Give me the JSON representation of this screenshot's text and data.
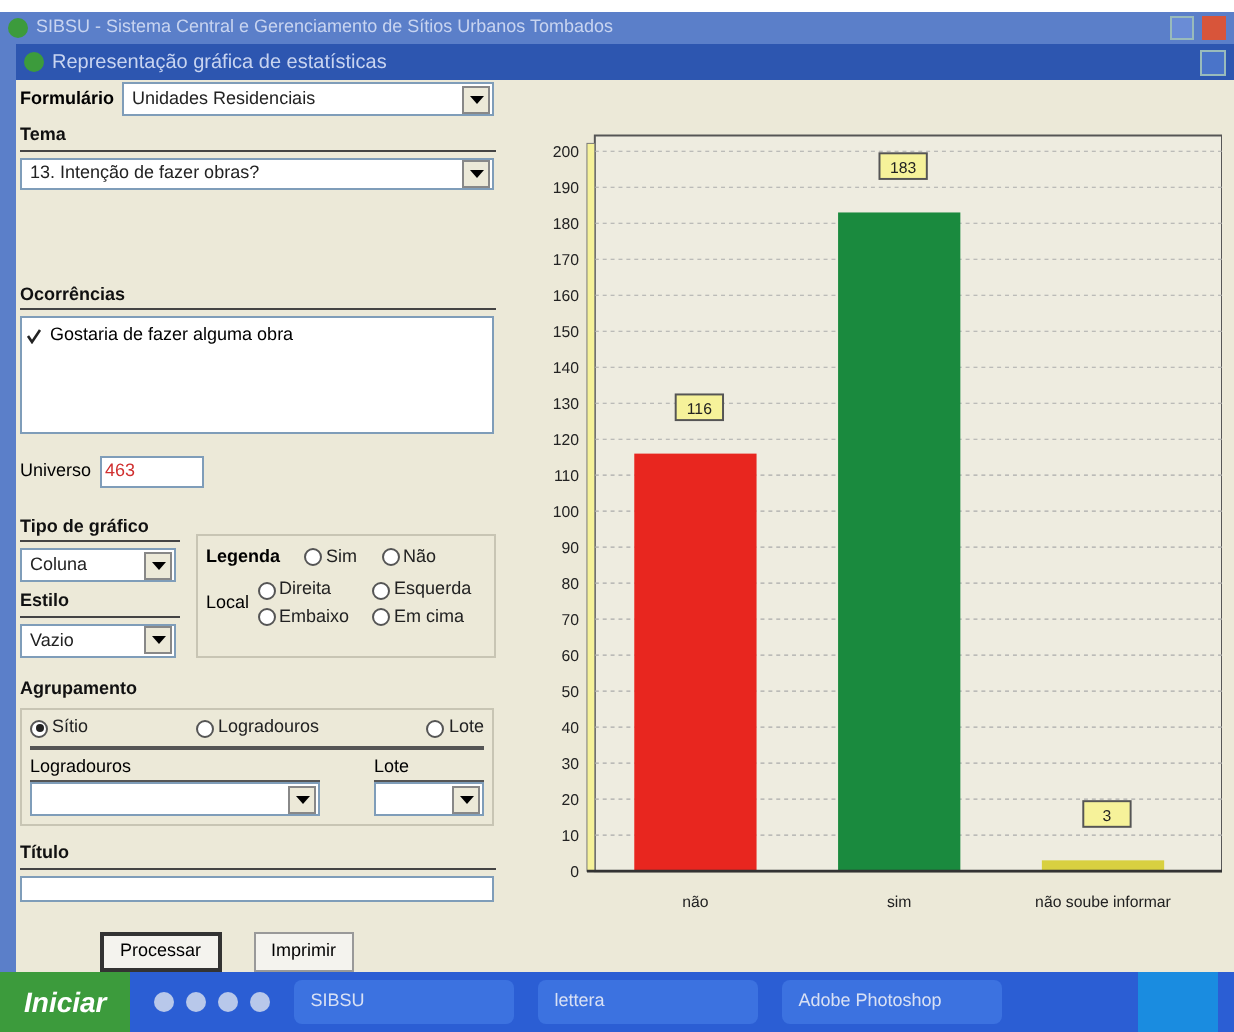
{
  "window": {
    "title": "SIBSU - Sistema Central e Gerenciamento de Sítios Urbanos Tombados"
  },
  "dialog": {
    "title": "Representação gráfica de estatísticas"
  },
  "form": {
    "formulario": {
      "label": "Formulário",
      "value": "Unidades Residenciais"
    },
    "tema": {
      "label": "Tema",
      "value": "13. Intenção de fazer obras?"
    },
    "ocorrencias": {
      "label": "Ocorrências",
      "items": [
        {
          "label": "Gostaria de fazer alguma obra",
          "checked": true
        }
      ]
    },
    "universo": {
      "label": "Universo",
      "value": "463"
    },
    "tipo_grafico": {
      "label": "Tipo de gráfico",
      "value": "Coluna"
    },
    "legenda": {
      "label": "Legenda",
      "options": [
        {
          "label": "Sim",
          "selected": false
        },
        {
          "label": "Não",
          "selected": false
        }
      ]
    },
    "estilo": {
      "label": "Estilo",
      "value": "Vazio"
    },
    "local": {
      "label": "Local",
      "options": [
        {
          "label": "Direita",
          "selected": false
        },
        {
          "label": "Esquerda",
          "selected": false
        },
        {
          "label": "Embaixo",
          "selected": false
        },
        {
          "label": "Em cima",
          "selected": false
        }
      ]
    },
    "agrupamento": {
      "label": "Agrupamento",
      "options": [
        {
          "label": "Sítio",
          "selected": true
        },
        {
          "label": "Logradouros",
          "selected": false
        },
        {
          "label": "Lote",
          "selected": false
        }
      ]
    },
    "logradouros": {
      "label": "Logradouros"
    },
    "lote": {
      "label": "Lote"
    },
    "titulo": {
      "label": "Título"
    },
    "buttons": [
      "Processar",
      "Imprimir"
    ]
  },
  "chart": {
    "chart_data": {
      "type": "bar",
      "categories": [
        "não",
        "sim",
        "não soube informar"
      ],
      "values": [
        116,
        183,
        3
      ],
      "colors": [
        "#e8261f",
        "#1a8a3e",
        "#d8d040"
      ],
      "ylim": [
        0,
        200
      ],
      "yticks": [
        0,
        10,
        20,
        30,
        40,
        50,
        60,
        70,
        80,
        90,
        100,
        110,
        120,
        130,
        140,
        150,
        160,
        170,
        180,
        190,
        200
      ],
      "data_labels": true,
      "grid": true
    }
  },
  "taskbar": {
    "start": "Iniciar",
    "tasks": [
      "SIBSU",
      "lettera",
      "Adobe Photoshop"
    ]
  }
}
